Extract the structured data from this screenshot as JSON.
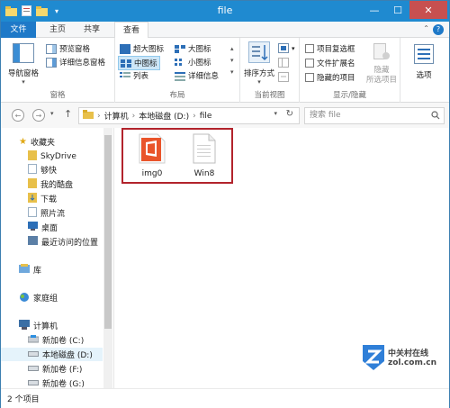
{
  "window": {
    "title": "file"
  },
  "titlebar": {
    "min": "—",
    "max": "☐",
    "close": "✕"
  },
  "tabs": {
    "file": "文件",
    "home": "主页",
    "share": "共享",
    "view": "查看",
    "help": "?"
  },
  "ribbon": {
    "panes": {
      "nav_pane": "导航窗格",
      "preview": "预览窗格",
      "details": "详细信息窗格",
      "label": "窗格"
    },
    "layout": {
      "xl_icons": "超大图标",
      "large_icons": "大图标",
      "medium_icons": "中图标",
      "small_icons": "小图标",
      "list": "列表",
      "details": "详细信息",
      "label": "布局"
    },
    "current_view": {
      "sort": "排序方式",
      "label": "当前视图"
    },
    "show_hide": {
      "checkboxes": "项目复选框",
      "extensions": "文件扩展名",
      "hidden_items": "隐藏的项目",
      "hide_selected": "隐藏\n所选项目",
      "label": "显示/隐藏"
    },
    "options": {
      "label": "选项"
    }
  },
  "address": {
    "path": [
      "计算机",
      "本地磁盘 (D:)",
      "file"
    ],
    "search_placeholder": "搜索 file"
  },
  "navpane": {
    "favorites": "收藏夹",
    "favorites_items": [
      "SkyDrive",
      "够快",
      "我的酷盘",
      "下载",
      "照片流",
      "桌面",
      "最近访问的位置"
    ],
    "library": "库",
    "homegroup": "家庭组",
    "computer": "计算机",
    "drives": [
      "新加卷 (C:)",
      "本地磁盘 (D:)",
      "新加卷 (F:)",
      "新加卷 (G:)"
    ]
  },
  "files": [
    {
      "name": "img0"
    },
    {
      "name": "Win8"
    }
  ],
  "status": {
    "count": "2 个项目"
  },
  "watermark": {
    "brand_cn": "中关村在线",
    "brand_en": "zol.com.cn"
  }
}
